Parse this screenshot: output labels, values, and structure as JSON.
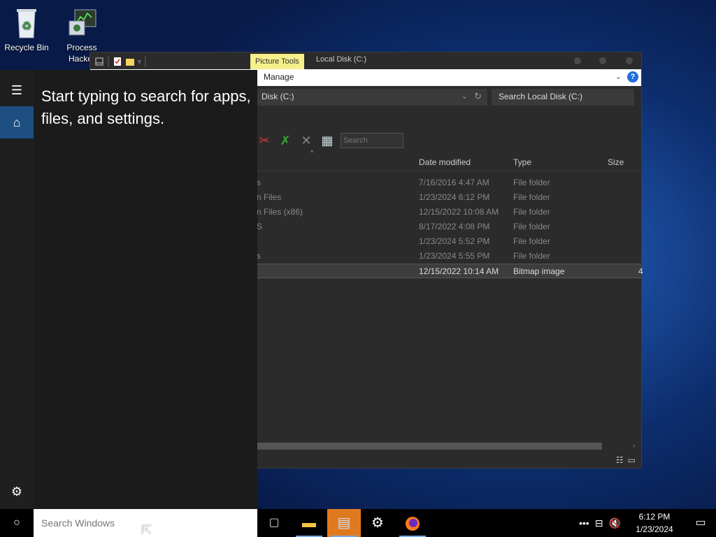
{
  "desktop": {
    "icons": [
      {
        "label": "Recycle Bin"
      },
      {
        "label": "Process Hacker"
      }
    ]
  },
  "explorer": {
    "context_tab": "Picture Tools",
    "window_title": "Local Disk (C:)",
    "ribbon_tab": "Manage",
    "address": "Disk (C:)",
    "search_placeholder": "Search Local Disk (C:)",
    "toolbar_search_placeholder": "Search",
    "columns": {
      "date_modified": "Date modified",
      "type": "Type",
      "size": "Size"
    },
    "rows": [
      {
        "name": "s",
        "date": "7/16/2016 4:47 AM",
        "type": "File folder",
        "size": ""
      },
      {
        "name": "n Files",
        "date": "1/23/2024 6:12 PM",
        "type": "File folder",
        "size": ""
      },
      {
        "name": "n Files (x86)",
        "date": "12/15/2022 10:08 AM",
        "type": "File folder",
        "size": ""
      },
      {
        "name": "S",
        "date": "8/17/2022 4:08 PM",
        "type": "File folder",
        "size": ""
      },
      {
        "name": "",
        "date": "1/23/2024 5:52 PM",
        "type": "File folder",
        "size": ""
      },
      {
        "name": "s",
        "date": "1/23/2024 5:55 PM",
        "type": "File folder",
        "size": ""
      },
      {
        "name": "",
        "date": "12/15/2022 10:14 AM",
        "type": "Bitmap image",
        "size": "4"
      }
    ]
  },
  "start_menu": {
    "prompt": "Start typing to search for apps, files, and settings."
  },
  "taskbar": {
    "search_placeholder": "Search Windows",
    "time": "6:12 PM",
    "date": "1/23/2024"
  },
  "colors": {
    "accent": "#1e4f82",
    "picture_tools": "#f5ef8c",
    "active_task": "#e07a1f"
  }
}
